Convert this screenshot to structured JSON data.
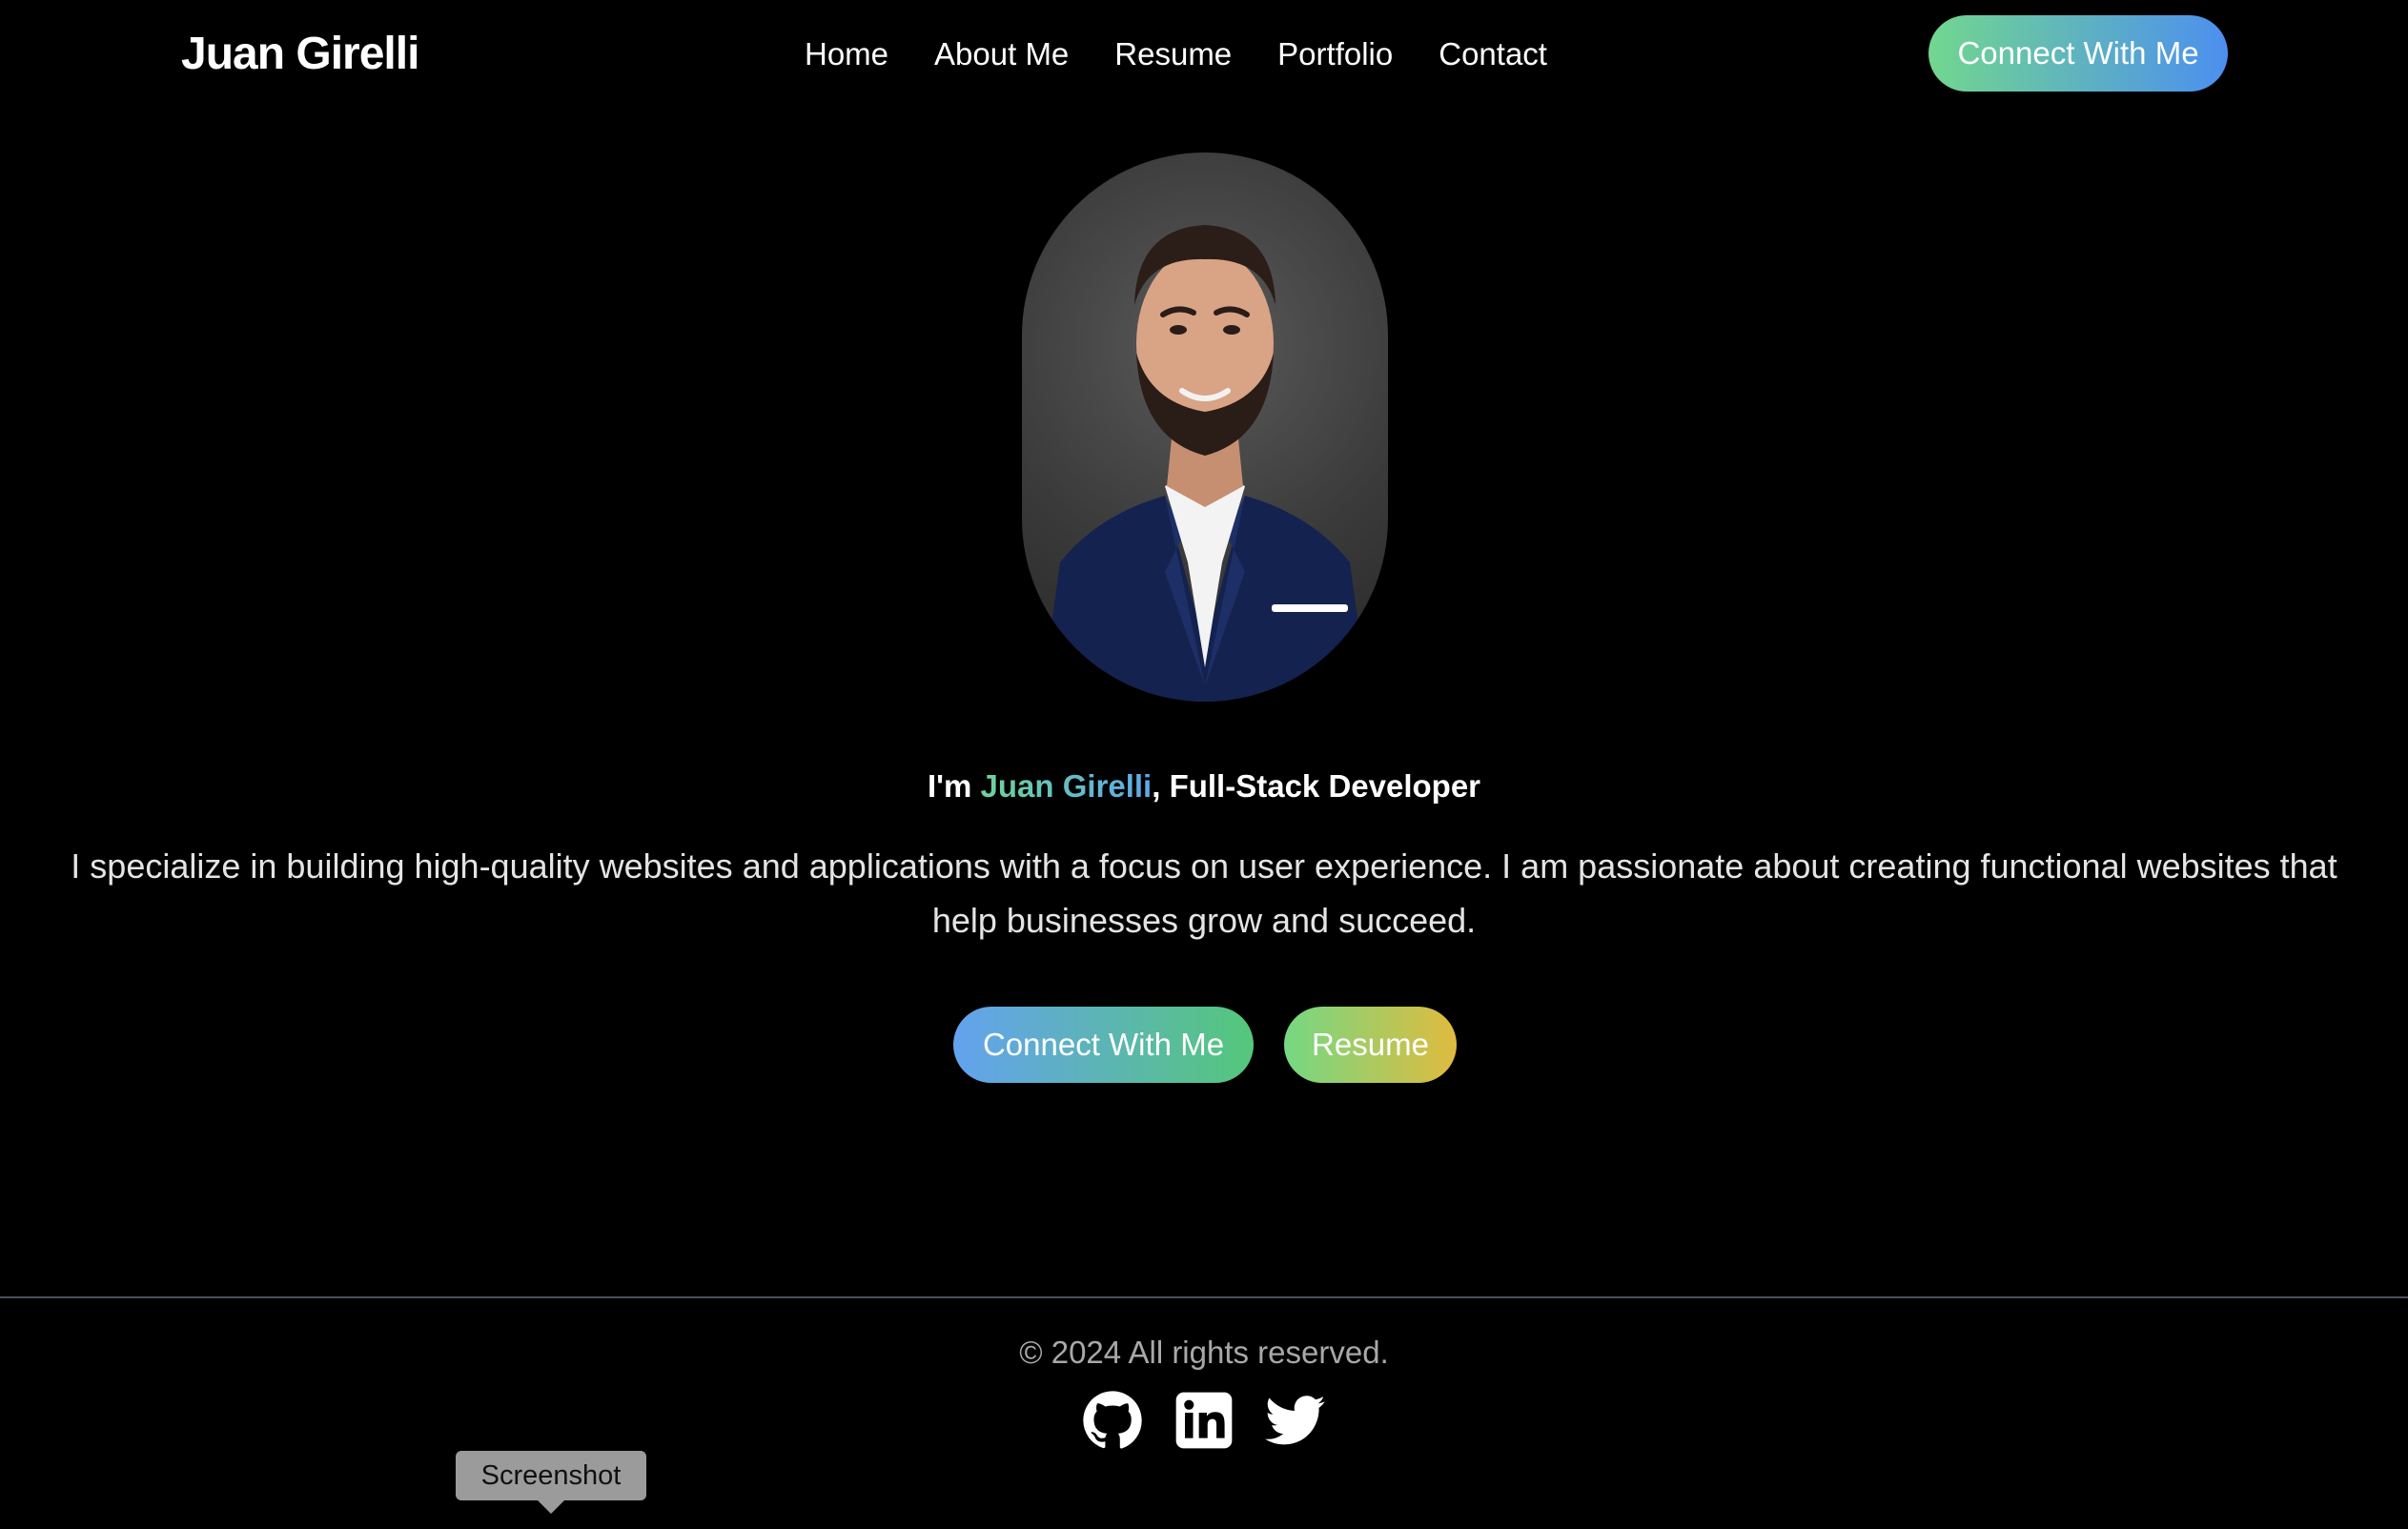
{
  "header": {
    "brand": "Juan Girelli",
    "nav": [
      "Home",
      "About Me",
      "Resume",
      "Portfolio",
      "Contact"
    ],
    "cta_label": "Connect With Me"
  },
  "hero": {
    "portrait_icon": "profile-photo",
    "headline_prefix": "I'm ",
    "headline_name": "Juan Girelli",
    "headline_suffix": ", Full-Stack Developer",
    "bio": "I specialize in building high-quality websites and applications with a focus on user experience. I am passionate about creating functional websites that help businesses grow and succeed.",
    "primary_button": "Connect With Me",
    "secondary_button": "Resume"
  },
  "footer": {
    "copyright": "© 2024 All rights reserved.",
    "social_icons": [
      "github-icon",
      "linkedin-icon",
      "twitter-icon"
    ]
  },
  "tooltip": {
    "label": "Screenshot"
  },
  "colors": {
    "background": "#000000",
    "text": "#ffffff",
    "muted_text": "#a8a8a8",
    "accent_green": "#6fd39a",
    "accent_blue": "#4c8ff0",
    "accent_gold": "#e0bb3f",
    "divider": "#4a4f5a"
  }
}
